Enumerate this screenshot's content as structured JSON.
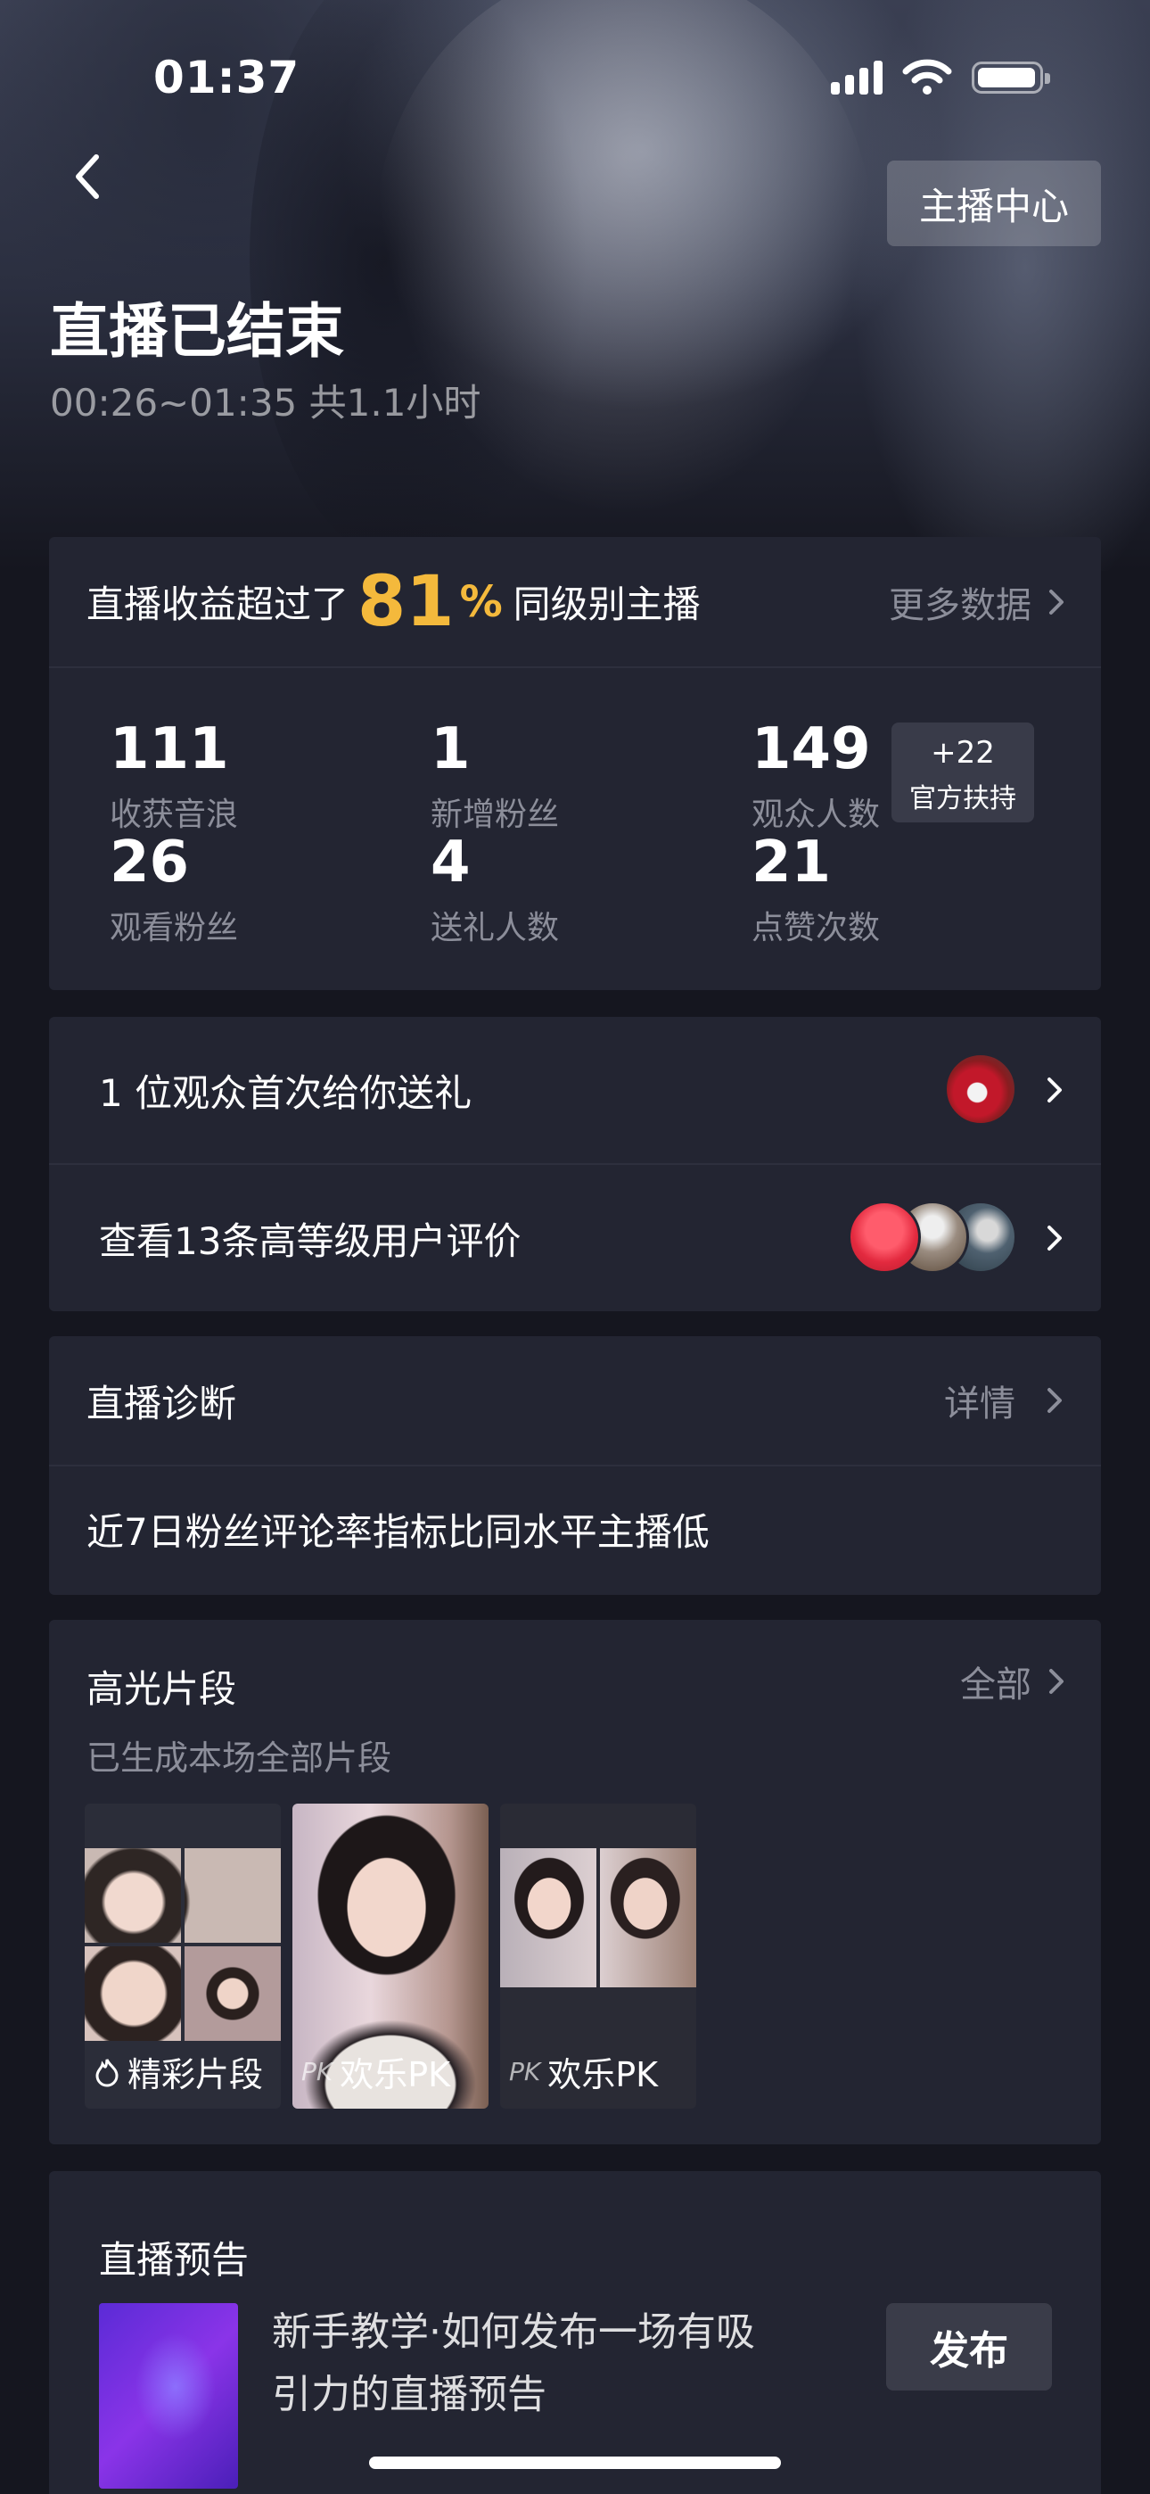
{
  "status_bar": {
    "time": "01:37"
  },
  "header": {
    "anchor_center_label": "主播中心",
    "title": "直播已结束",
    "time_range": "00:26~01:35 共1.1小时"
  },
  "summary": {
    "prefix": "直播收益超过了",
    "percent": "81",
    "percent_sign": "%",
    "suffix": "同级别主播",
    "more_label": "更多数据",
    "stats": [
      {
        "value": "111",
        "label": "收获音浪"
      },
      {
        "value": "1",
        "label": "新增粉丝"
      },
      {
        "value": "149",
        "label": "观众人数"
      },
      {
        "value": "26",
        "label": "观看粉丝"
      },
      {
        "value": "4",
        "label": "送礼人数"
      },
      {
        "value": "21",
        "label": "点赞次数"
      }
    ],
    "boost": {
      "value": "+22",
      "label": "官方扶持"
    }
  },
  "audience": {
    "gift_row": "1 位观众首次给你送礼",
    "review_row": "查看13条高等级用户评价"
  },
  "diagnosis": {
    "title": "直播诊断",
    "detail_label": "详情",
    "text": "近7日粉丝评论率指标比同水平主播低"
  },
  "highlights": {
    "title": "高光片段",
    "all_label": "全部",
    "subtitle": "已生成本场全部片段",
    "clips": [
      {
        "label": "精彩片段",
        "icon": "fire-icon"
      },
      {
        "label": "欢乐PK",
        "icon": "pk-icon"
      },
      {
        "label": "欢乐PK",
        "icon": "pk-icon"
      }
    ]
  },
  "preview": {
    "title": "直播预告",
    "line1": "新手教学·如何发布一场有吸",
    "line2": "引力的直播预告",
    "publish_label": "发布"
  },
  "colors": {
    "accent": "#f4b93c",
    "card": "#232532",
    "background": "#15161f"
  }
}
